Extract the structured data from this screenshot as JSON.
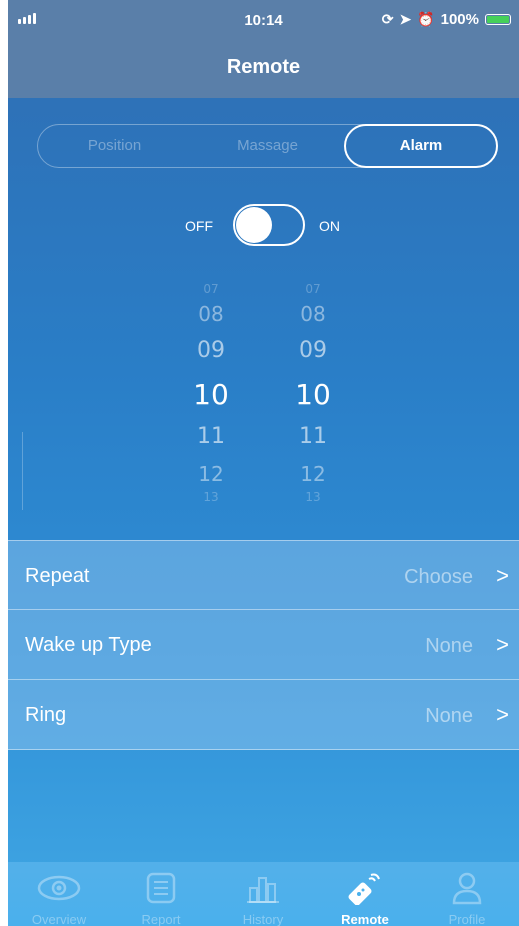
{
  "status_bar": {
    "time": "10:14",
    "battery": "100%"
  },
  "nav": {
    "title": "Remote"
  },
  "segment": {
    "items": [
      "Position",
      "Massage",
      "Alarm"
    ],
    "selected": "Alarm"
  },
  "alarm_toggle": {
    "off_label": "OFF",
    "on_label": "ON",
    "state": "off"
  },
  "hour_picker": {
    "values": [
      "07",
      "08",
      "09",
      "10",
      "11",
      "12",
      "13"
    ],
    "selected": "10"
  },
  "minute_picker": {
    "values": [
      "07",
      "08",
      "09",
      "10",
      "11",
      "12",
      "13"
    ],
    "selected": "10"
  },
  "settings": [
    {
      "label": "Repeat",
      "value": "Choose",
      "chevron": ">"
    },
    {
      "label": "Wake up Type",
      "value": "None",
      "chevron": ">"
    },
    {
      "label": "Ring",
      "value": "None",
      "chevron": ">"
    }
  ],
  "tab_bar": {
    "tabs": [
      {
        "label": "Overview",
        "icon": "eye-icon"
      },
      {
        "label": "Report",
        "icon": "list-icon"
      },
      {
        "label": "History",
        "icon": "bar-chart-icon"
      },
      {
        "label": "Remote",
        "icon": "remote-icon"
      },
      {
        "label": "Profile",
        "icon": "person-icon"
      }
    ],
    "active": "Remote"
  },
  "colors": {
    "header": "#5a7fa9",
    "background_top": "#2f6db2",
    "background_bottom": "#40a7e4",
    "battery": "#46d15a"
  }
}
